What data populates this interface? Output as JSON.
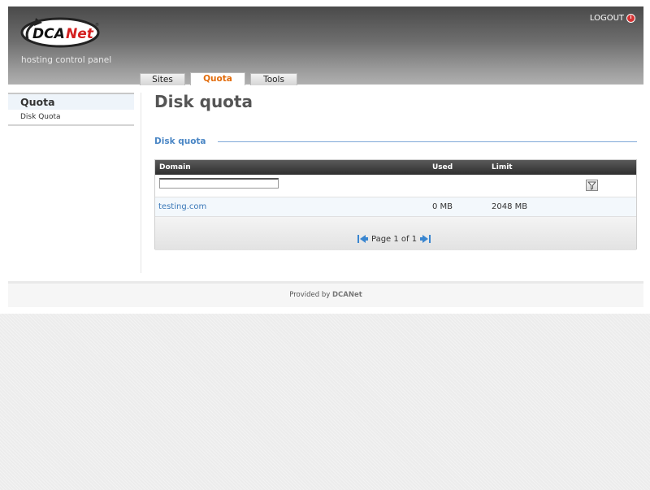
{
  "header": {
    "subtitle": "hosting control panel",
    "logout_label": "LOGOUT"
  },
  "tabs": [
    {
      "label": "Sites",
      "active": false
    },
    {
      "label": "Quota",
      "active": true
    },
    {
      "label": "Tools",
      "active": false
    }
  ],
  "sidebar": {
    "title": "Quota",
    "items": [
      {
        "label": "Disk Quota"
      }
    ]
  },
  "main": {
    "page_title": "Disk quota",
    "section_title": "Disk quota",
    "grid": {
      "columns": [
        "Domain",
        "Used",
        "Limit"
      ],
      "filter_value": "",
      "rows": [
        {
          "domain": "testing.com",
          "used": "0 MB",
          "limit": "2048 MB"
        }
      ],
      "pager_text": "Page 1 of 1"
    }
  },
  "footer": {
    "prefix": "Provided by",
    "brand": "DCANet"
  },
  "colors": {
    "accent_tab": "#e26b0a",
    "link": "#3a78b8",
    "section": "#4a86c5"
  }
}
